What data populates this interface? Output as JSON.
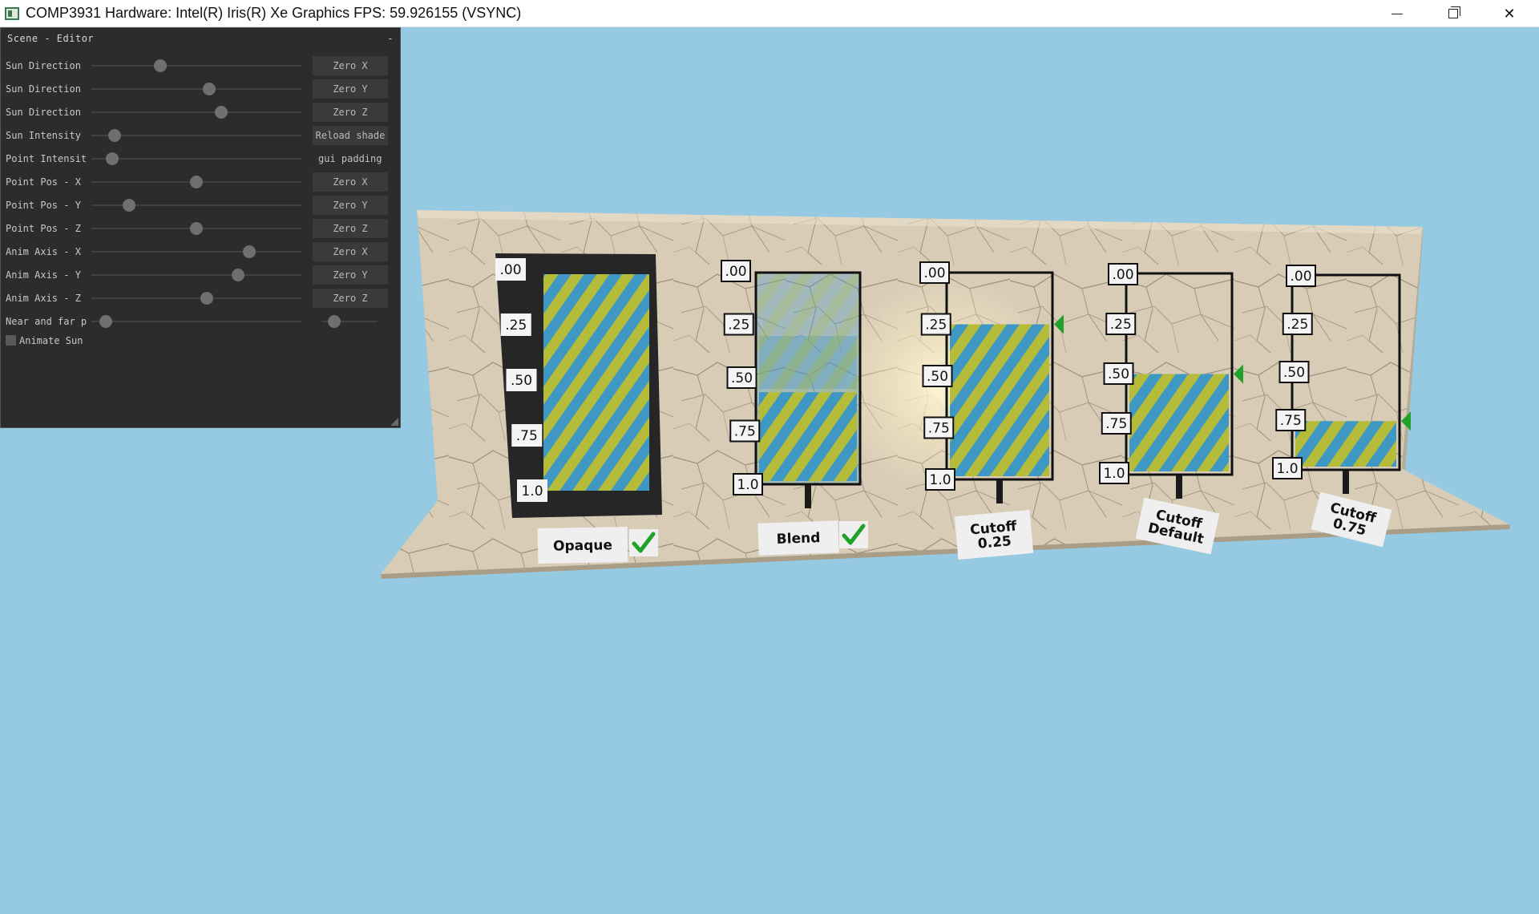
{
  "window": {
    "title": "COMP3931 Hardware: Intel(R) Iris(R) Xe Graphics FPS: 59.926155 (VSYNC)"
  },
  "panel": {
    "title": "Scene - Editor",
    "collapse_symbol": "-",
    "rows": [
      {
        "label": "Sun Direction",
        "value": 0.33,
        "button": "Zero X"
      },
      {
        "label": "Sun Direction",
        "value": 0.56,
        "button": "Zero Y"
      },
      {
        "label": "Sun Direction",
        "value": 0.62,
        "button": "Zero Z"
      },
      {
        "label": "Sun Intensity",
        "value": 0.11,
        "button": "Reload shade"
      },
      {
        "label": "Point Intensit",
        "value": 0.1,
        "text": "gui padding"
      },
      {
        "label": "Point Pos - X",
        "value": 0.5,
        "button": "Zero X"
      },
      {
        "label": "Point Pos - Y",
        "value": 0.18,
        "button": "Zero Y"
      },
      {
        "label": "Point Pos - Z",
        "value": 0.5,
        "button": "Zero Z"
      },
      {
        "label": "Anim Axis - X",
        "value": 0.75,
        "button": "Zero X"
      },
      {
        "label": "Anim Axis - Y",
        "value": 0.7,
        "button": "Zero Y"
      },
      {
        "label": "Anim Axis - Z",
        "value": 0.55,
        "button": "Zero Z"
      },
      {
        "label": "Near and far p",
        "value": 0.07,
        "value2": 0.12
      }
    ],
    "checkbox": {
      "label": "Animate Sun",
      "checked": false
    }
  },
  "scene": {
    "scale_ticks": [
      ".00",
      ".25",
      ".50",
      ".75",
      "1.0"
    ],
    "panels": [
      {
        "id": "opaque",
        "caption_lines": [
          "Opaque"
        ],
        "checked": true,
        "fill_from": 0.0
      },
      {
        "id": "blend",
        "caption_lines": [
          "Blend"
        ],
        "checked": true,
        "fill_from": 0.0
      },
      {
        "id": "cutoff-025",
        "caption_lines": [
          "Cutoff",
          "0.25"
        ],
        "checked": false,
        "fill_from": 0.25
      },
      {
        "id": "cutoff-default",
        "caption_lines": [
          "Cutoff",
          "Default"
        ],
        "checked": false,
        "fill_from": 0.5
      },
      {
        "id": "cutoff-075",
        "caption_lines": [
          "Cutoff",
          "0.75"
        ],
        "checked": false,
        "fill_from": 0.75
      }
    ],
    "colors": {
      "sky": "#96cae2",
      "stripe_blue": "#3f98c4",
      "stripe_yellow": "#b4bc3a",
      "marker_green": "#1fa12a",
      "marble": "#d9cdb8"
    },
    "icons": {
      "check": "check-icon",
      "marker": "triangle-marker-icon"
    }
  }
}
